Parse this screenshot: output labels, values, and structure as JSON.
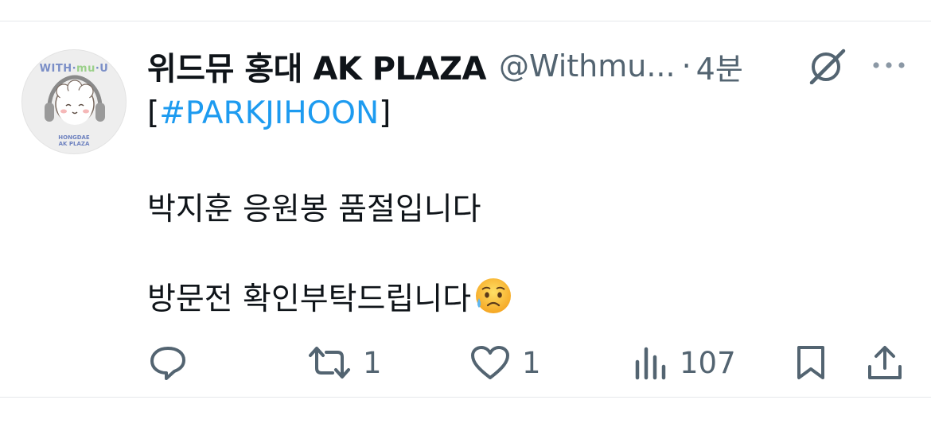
{
  "tweet": {
    "display_name": "위드뮤 홍대 AK PLAZA",
    "handle": "@Withmu...",
    "separator": "·",
    "time": "4분",
    "line1_prefix": "[",
    "hashtag": "#PARKJIHOON",
    "line1_suffix": "]",
    "line2": "박지훈 응원봉 품절입니다",
    "line3": "방문전 확인부탁드립니다",
    "line3_emoji": "sad-but-relieved-face"
  },
  "avatar": {
    "brand_part1": "WITH·",
    "brand_part2": "mu",
    "brand_part3": "·U",
    "sub_line1": "HONGDAE",
    "sub_line2": "AK PLAZA"
  },
  "actions": {
    "reply": {
      "icon": "reply-icon"
    },
    "retweet": {
      "icon": "retweet-icon",
      "count": "1"
    },
    "like": {
      "icon": "heart-icon",
      "count": "1"
    },
    "views": {
      "icon": "views-icon",
      "count": "107"
    },
    "bookmark": {
      "icon": "bookmark-icon"
    },
    "share": {
      "icon": "share-icon"
    }
  },
  "colors": {
    "link": "#1d9bf0",
    "muted": "#536471",
    "text": "#0f1419",
    "divider": "#e6e8eb"
  }
}
